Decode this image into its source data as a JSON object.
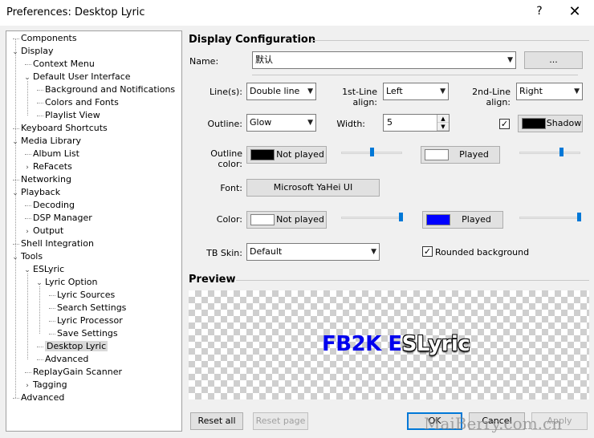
{
  "window": {
    "title": "Preferences: Desktop Lyric",
    "help_glyph": "?",
    "close_glyph": "✕"
  },
  "tree": {
    "items": [
      {
        "label": "Components",
        "level": 0,
        "exp": ""
      },
      {
        "label": "Display",
        "level": 0,
        "exp": "⌄"
      },
      {
        "label": "Context Menu",
        "level": 1,
        "exp": ""
      },
      {
        "label": "Default User Interface",
        "level": 1,
        "exp": "⌄"
      },
      {
        "label": "Background and Notifications",
        "level": 2,
        "exp": ""
      },
      {
        "label": "Colors and Fonts",
        "level": 2,
        "exp": ""
      },
      {
        "label": "Playlist View",
        "level": 2,
        "exp": ""
      },
      {
        "label": "Keyboard Shortcuts",
        "level": 0,
        "exp": ""
      },
      {
        "label": "Media Library",
        "level": 0,
        "exp": "⌄"
      },
      {
        "label": "Album List",
        "level": 1,
        "exp": ""
      },
      {
        "label": "ReFacets",
        "level": 1,
        "exp": "›"
      },
      {
        "label": "Networking",
        "level": 0,
        "exp": ""
      },
      {
        "label": "Playback",
        "level": 0,
        "exp": "⌄"
      },
      {
        "label": "Decoding",
        "level": 1,
        "exp": ""
      },
      {
        "label": "DSP Manager",
        "level": 1,
        "exp": ""
      },
      {
        "label": "Output",
        "level": 1,
        "exp": "›"
      },
      {
        "label": "Shell Integration",
        "level": 0,
        "exp": ""
      },
      {
        "label": "Tools",
        "level": 0,
        "exp": "⌄"
      },
      {
        "label": "ESLyric",
        "level": 1,
        "exp": "⌄"
      },
      {
        "label": "Lyric Option",
        "level": 2,
        "exp": "⌄"
      },
      {
        "label": "Lyric Sources",
        "level": 3,
        "exp": ""
      },
      {
        "label": "Search Settings",
        "level": 3,
        "exp": ""
      },
      {
        "label": "Lyric Processor",
        "level": 3,
        "exp": ""
      },
      {
        "label": "Save Settings",
        "level": 3,
        "exp": ""
      },
      {
        "label": "Desktop Lyric",
        "level": 2,
        "exp": "",
        "selected": true
      },
      {
        "label": "Advanced",
        "level": 2,
        "exp": ""
      },
      {
        "label": "ReplayGain Scanner",
        "level": 1,
        "exp": ""
      },
      {
        "label": "Tagging",
        "level": 1,
        "exp": "›"
      },
      {
        "label": "Advanced",
        "level": 0,
        "exp": ""
      }
    ]
  },
  "display": {
    "section_title": "Display Configuration",
    "name_label": "Name:",
    "name_value": "默认",
    "ellipsis_button": "...",
    "lines_label": "Line(s):",
    "lines_value": "Double line",
    "first_align_label": "1st-Line align:",
    "first_align_value": "Left",
    "second_align_label": "2nd-Line align:",
    "second_align_value": "Right",
    "outline_label": "Outline:",
    "outline_value": "Glow",
    "width_label": "Width:",
    "width_value": "5",
    "shadow_checked": true,
    "shadow_label": "Shadow",
    "shadow_color": "#000000",
    "outline_color_label": "Outline color:",
    "outline_not_played": {
      "label": "Not played",
      "color": "#000000",
      "slider_level": 0.5
    },
    "outline_played": {
      "label": "Played",
      "color": "#ffffff",
      "slider_level": 0.69
    },
    "font_label": "Font:",
    "font_value": "Microsoft YaHei UI",
    "color_label": "Color:",
    "color_not_played": {
      "label": "Not played",
      "color": "#ffffff",
      "slider_level": 0.97
    },
    "color_played": {
      "label": "Played",
      "color": "#0000ff",
      "slider_level": 0.97
    },
    "tb_skin_label": "TB Skin:",
    "tb_skin_value": "Default",
    "rounded_checked": true,
    "rounded_label": "Rounded background"
  },
  "preview": {
    "section_title": "Preview",
    "played_text": "FB2K E",
    "unplayed_text": "SLyric",
    "played_color": "#0000ee"
  },
  "footer": {
    "reset_all": "Reset all",
    "reset_page": "Reset page",
    "ok": "OK",
    "cancel": "Cancel",
    "apply": "Apply",
    "watermark": "MaiBerry.com.cn"
  }
}
